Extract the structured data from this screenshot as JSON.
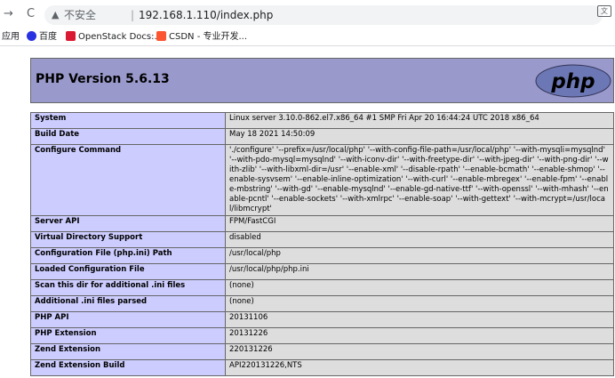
{
  "browser": {
    "back_icon": "back-arrow-icon",
    "reload_icon": "reload-icon",
    "security_label": "不安全",
    "separator": "|",
    "url": "192.168.1.110/index.php",
    "bookmarks": [
      {
        "label": "应用",
        "icon": "apps-icon",
        "color": "#1a73e8"
      },
      {
        "label": "百度",
        "icon": "baidu-paw-icon",
        "color": "#2932e1"
      },
      {
        "label": "OpenStack Docs:...",
        "icon": "openstack-icon",
        "color": "#da1a32"
      },
      {
        "label": "CSDN - 专业开发...",
        "icon": "csdn-icon",
        "color": "#fc5531"
      }
    ]
  },
  "phpinfo": {
    "title": "PHP Version 5.6.13",
    "logo_text": "php",
    "rows": [
      {
        "key": "System",
        "value": "Linux server 3.10.0-862.el7.x86_64 #1 SMP Fri Apr 20 16:44:24 UTC 2018 x86_64"
      },
      {
        "key": "Build Date",
        "value": "May 18 2021 14:50:09"
      },
      {
        "key": "Configure Command",
        "value": "'./configure' '--prefix=/usr/local/php' '--with-config-file-path=/usr/local/php' '--with-mysqli=mysqlnd' '--with-pdo-mysql=mysqlnd' '--with-iconv-dir' '--with-freetype-dir' '--with-jpeg-dir' '--with-png-dir' '--with-zlib' '--with-libxml-dir=/usr' '--enable-xml' '--disable-rpath' '--enable-bcmath' '--enable-shmop' '--enable-sysvsem' '--enable-inline-optimization' '--with-curl' '--enable-mbregex' '--enable-fpm' '--enable-mbstring' '--with-gd' '--enable-mysqlnd' '--enable-gd-native-ttf' '--with-openssl' '--with-mhash' '--enable-pcntl' '--enable-sockets' '--with-xmlrpc' '--enable-soap' '--with-gettext' '--with-mcrypt=/usr/local/libmcrypt'"
      },
      {
        "key": "Server API",
        "value": "FPM/FastCGI"
      },
      {
        "key": "Virtual Directory Support",
        "value": "disabled"
      },
      {
        "key": "Configuration File (php.ini) Path",
        "value": "/usr/local/php"
      },
      {
        "key": "Loaded Configuration File",
        "value": "/usr/local/php/php.ini"
      },
      {
        "key": "Scan this dir for additional .ini files",
        "value": "(none)"
      },
      {
        "key": "Additional .ini files parsed",
        "value": "(none)"
      },
      {
        "key": "PHP API",
        "value": "20131106"
      },
      {
        "key": "PHP Extension",
        "value": "20131226"
      },
      {
        "key": "Zend Extension",
        "value": "220131226"
      },
      {
        "key": "Zend Extension Build",
        "value": "API220131226,NTS"
      }
    ]
  }
}
